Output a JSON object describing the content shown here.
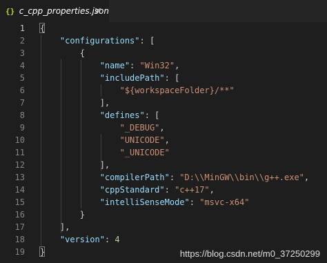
{
  "tab": {
    "icon_text": "{}",
    "title": "c_cpp_properties.json",
    "close_symbol": "×"
  },
  "editor": {
    "lines": [
      {
        "n": "1",
        "tokens": [
          {
            "t": "p",
            "v": "{"
          }
        ]
      },
      {
        "n": "2",
        "tokens": [
          {
            "t": "k",
            "v": "    \"configurations\""
          },
          {
            "t": "p",
            "v": ": ["
          }
        ]
      },
      {
        "n": "3",
        "tokens": [
          {
            "t": "p",
            "v": "        {"
          }
        ]
      },
      {
        "n": "4",
        "tokens": [
          {
            "t": "k",
            "v": "            \"name\""
          },
          {
            "t": "p",
            "v": ": "
          },
          {
            "t": "s",
            "v": "\"Win32\""
          },
          {
            "t": "p",
            "v": ","
          }
        ]
      },
      {
        "n": "5",
        "tokens": [
          {
            "t": "k",
            "v": "            \"includePath\""
          },
          {
            "t": "p",
            "v": ": ["
          }
        ]
      },
      {
        "n": "6",
        "tokens": [
          {
            "t": "s",
            "v": "                \"${workspaceFolder}/**\""
          }
        ]
      },
      {
        "n": "7",
        "tokens": [
          {
            "t": "p",
            "v": "            ],"
          }
        ]
      },
      {
        "n": "8",
        "tokens": [
          {
            "t": "k",
            "v": "            \"defines\""
          },
          {
            "t": "p",
            "v": ": ["
          }
        ]
      },
      {
        "n": "9",
        "tokens": [
          {
            "t": "s",
            "v": "                \"_DEBUG\""
          },
          {
            "t": "p",
            "v": ","
          }
        ]
      },
      {
        "n": "10",
        "tokens": [
          {
            "t": "s",
            "v": "                \"UNICODE\""
          },
          {
            "t": "p",
            "v": ","
          }
        ]
      },
      {
        "n": "11",
        "tokens": [
          {
            "t": "s",
            "v": "                \"_UNICODE\""
          }
        ]
      },
      {
        "n": "12",
        "tokens": [
          {
            "t": "p",
            "v": "            ],"
          }
        ]
      },
      {
        "n": "13",
        "tokens": [
          {
            "t": "k",
            "v": "            \"compilerPath\""
          },
          {
            "t": "p",
            "v": ": "
          },
          {
            "t": "s",
            "v": "\"D:\\\\MinGW\\\\bin\\\\g++.exe\""
          },
          {
            "t": "p",
            "v": ","
          }
        ]
      },
      {
        "n": "14",
        "tokens": [
          {
            "t": "k",
            "v": "            \"cppStandard\""
          },
          {
            "t": "p",
            "v": ": "
          },
          {
            "t": "s",
            "v": "\"c++17\""
          },
          {
            "t": "p",
            "v": ","
          }
        ]
      },
      {
        "n": "15",
        "tokens": [
          {
            "t": "k",
            "v": "            \"intelliSenseMode\""
          },
          {
            "t": "p",
            "v": ": "
          },
          {
            "t": "s",
            "v": "\"msvc-x64\""
          }
        ]
      },
      {
        "n": "16",
        "tokens": [
          {
            "t": "p",
            "v": "        }"
          }
        ]
      },
      {
        "n": "17",
        "tokens": [
          {
            "t": "p",
            "v": "    ],"
          }
        ]
      },
      {
        "n": "18",
        "tokens": [
          {
            "t": "k",
            "v": "    \"version\""
          },
          {
            "t": "p",
            "v": ": "
          },
          {
            "t": "n",
            "v": "4"
          }
        ]
      },
      {
        "n": "19",
        "tokens": [
          {
            "t": "p",
            "v": "}"
          }
        ]
      }
    ],
    "active_line": "1"
  },
  "watermark": "https://blog.csdn.net/m0_37250299",
  "colors": {
    "background": "#1e1e1e",
    "key": "#9cdcfe",
    "string": "#ce9178",
    "number": "#b5cea8",
    "punctuation": "#d4d4d4",
    "line_number": "#858585"
  }
}
